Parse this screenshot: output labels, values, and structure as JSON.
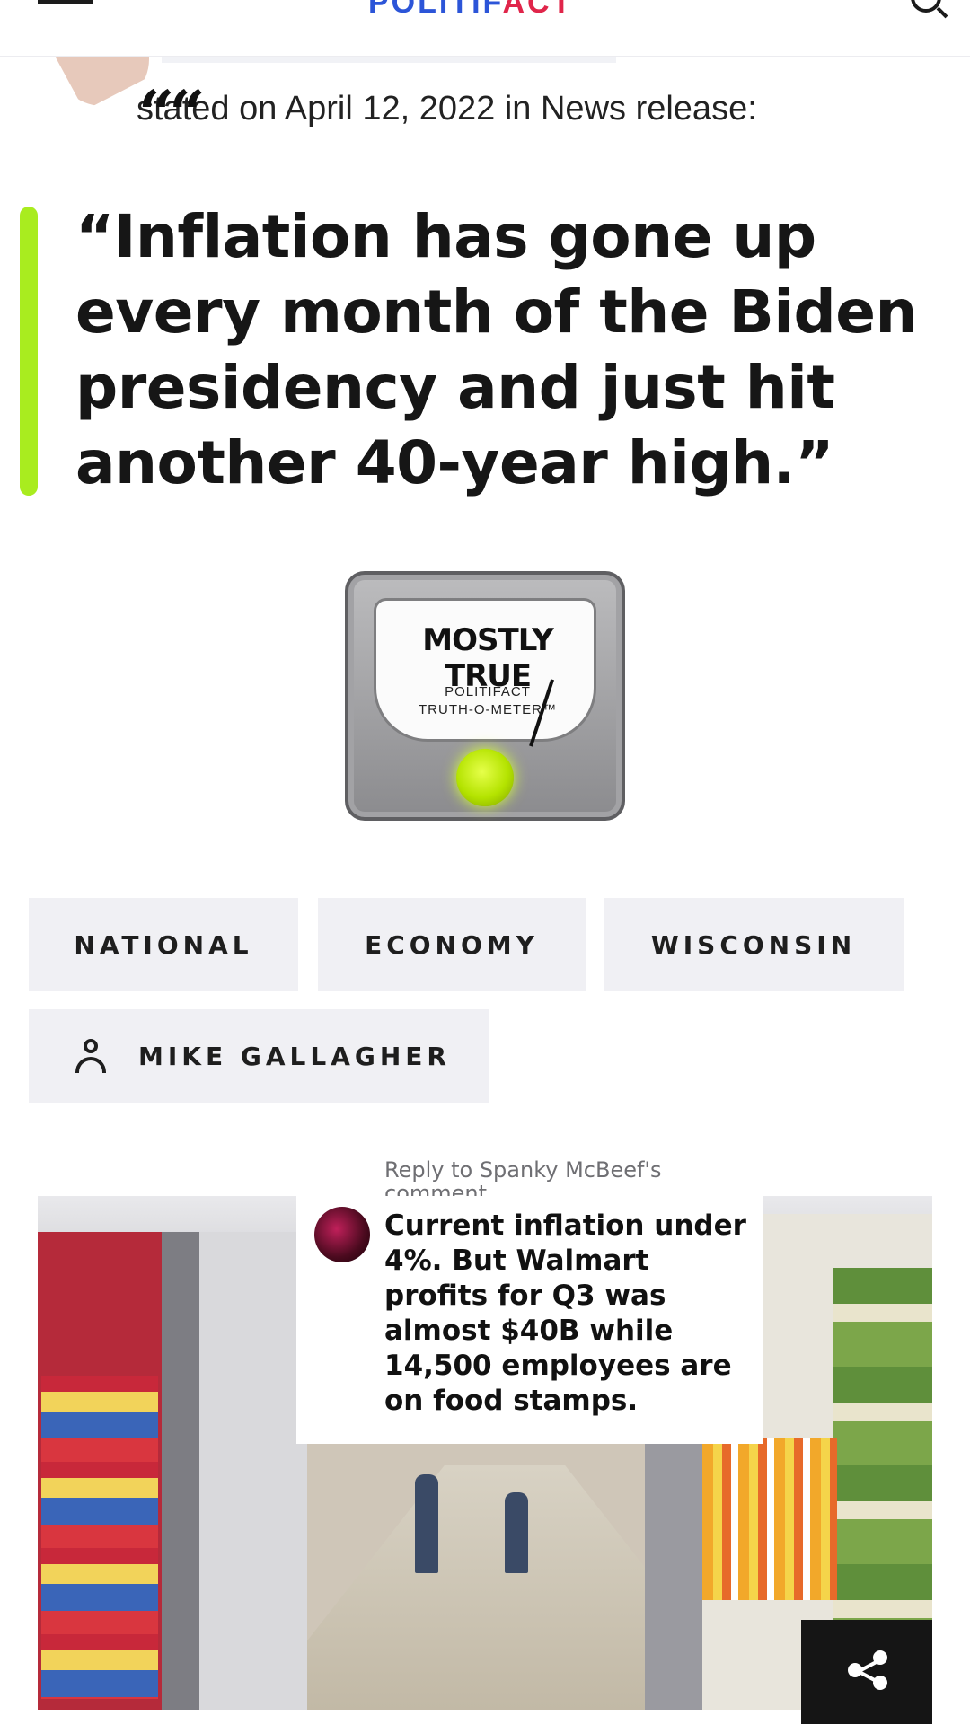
{
  "header": {
    "logo_main": "POLITIF",
    "logo_accent": "ACT"
  },
  "speaker": {
    "quote_glyph": "““",
    "stated_line": "stated on April 12, 2022 in News release:"
  },
  "statement": {
    "text": "“Inflation has gone up every month of the Biden presidency and just hit another 40-year high.”",
    "accent_color": "#a9ec1f"
  },
  "meter": {
    "rating": "MOSTLY TRUE",
    "brand_line1": "POLITIFACT",
    "brand_line2": "TRUTH-O-METER™",
    "light_color": "#b4e300"
  },
  "tags": {
    "national": "NATIONAL",
    "economy": "ECONOMY",
    "wisconsin": "WISCONSIN",
    "person": "MIKE GALLAGHER",
    "person_icon": "person-icon"
  },
  "comment": {
    "reply_label": "Reply to Spanky McBeef's comment",
    "text": "Current inflation under 4%. But Walmart profits for Q3 was almost $40B while 14,500 employees are on food stamps."
  },
  "share": {
    "icon": "share-icon"
  }
}
